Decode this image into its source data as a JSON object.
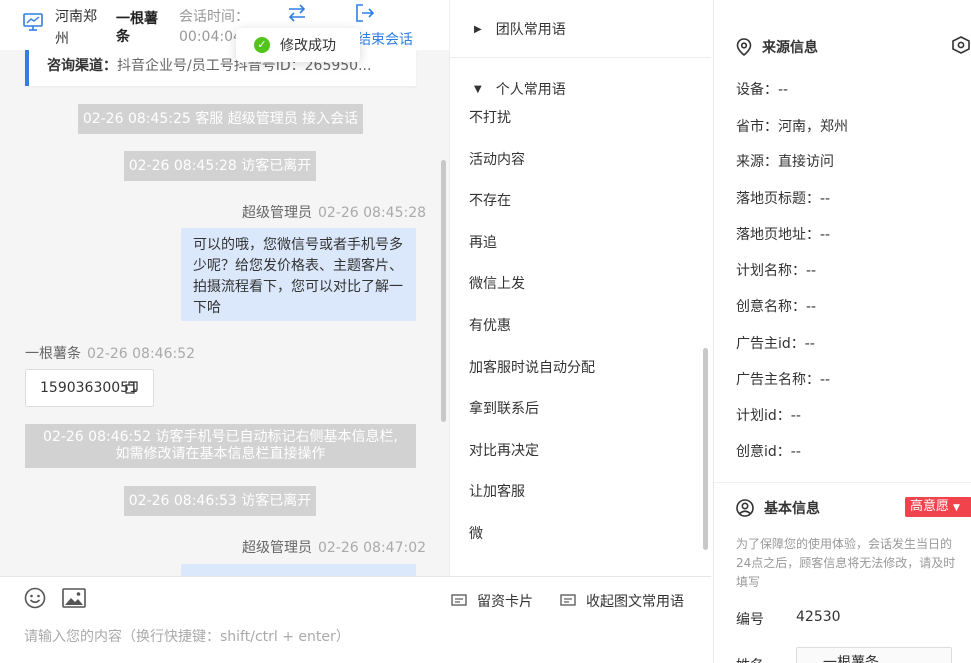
{
  "header": {
    "location": "河南郑州",
    "visitor_name": "一根薯条",
    "session_time_label": "会话时间：",
    "session_time": "00:04:04",
    "end_label": "结束会话"
  },
  "toast": {
    "message": "修改成功"
  },
  "channel": {
    "label": "咨询渠道：",
    "value": "抖音企业号/员工号抖音号ID：265950..."
  },
  "messages": {
    "sys1": "02-26 08:45:25 客服 超级管理员 接入会话",
    "sys2": "02-26 08:45:28 访客已离开",
    "agent1_name": "超级管理员",
    "agent1_time": "02-26 08:45:28",
    "agent1_text": "可以的哦，您微信号或者手机号多少呢？给您发价格表、主题客片、拍摄流程看下，您可以对比了解一下哈",
    "visitor_name": "一根薯条",
    "visitor_time": "02-26 08:46:52",
    "visitor_text": "15903630051",
    "sys3_line1": "02-26 08:46:52 访客手机号已自动标记右侧基本信息栏,",
    "sys3_line2": "如需修改请在基本信息栏直接操作",
    "sys4": "02-26 08:46:53 访客已离开",
    "agent2_name": "超级管理员",
    "agent2_time": "02-26 08:47:02"
  },
  "composer": {
    "card_label": "留资卡片",
    "phrases_label": "收起图文常用语",
    "placeholder": "请输入您的内容（换行快捷键：shift/ctrl + enter）"
  },
  "phrases": {
    "team_group": "团队常用语",
    "personal_group": "个人常用语",
    "items": [
      "不打扰",
      "活动内容",
      "不存在",
      "再追",
      "微信上发",
      "有优惠",
      "加客服时说自动分配",
      "拿到联系后",
      "对比再决定",
      "让加客服",
      "微"
    ]
  },
  "info": {
    "source_title": "来源信息",
    "fields": [
      {
        "label": "设备：",
        "value": "--"
      },
      {
        "label": "省市：",
        "value": "河南，郑州"
      },
      {
        "label": "来源：",
        "value": "直接访问"
      },
      {
        "label": "落地页标题：",
        "value": "--"
      },
      {
        "label": "落地页地址：",
        "value": "--"
      },
      {
        "label": "计划名称：",
        "value": "--"
      },
      {
        "label": "创意名称：",
        "value": "--"
      },
      {
        "label": "广告主id：",
        "value": "--"
      },
      {
        "label": "广告主名称：",
        "value": "--"
      },
      {
        "label": "计划id：",
        "value": "--"
      },
      {
        "label": "创意id：",
        "value": "--"
      }
    ],
    "basic_title": "基本信息",
    "intent_badge": "高意愿",
    "notice": "为了保障您的使用体验，会话发生当日的24点之后，顾客信息将无法修改，请及时填写",
    "number_label": "编号",
    "number_value": "42530",
    "name_label": "姓名",
    "name_value": "一根薯条"
  },
  "colors": {
    "accent": "#2f7fe6",
    "bubble": "#dbe8fb",
    "badge": "#f0434c",
    "success": "#52c41a"
  }
}
